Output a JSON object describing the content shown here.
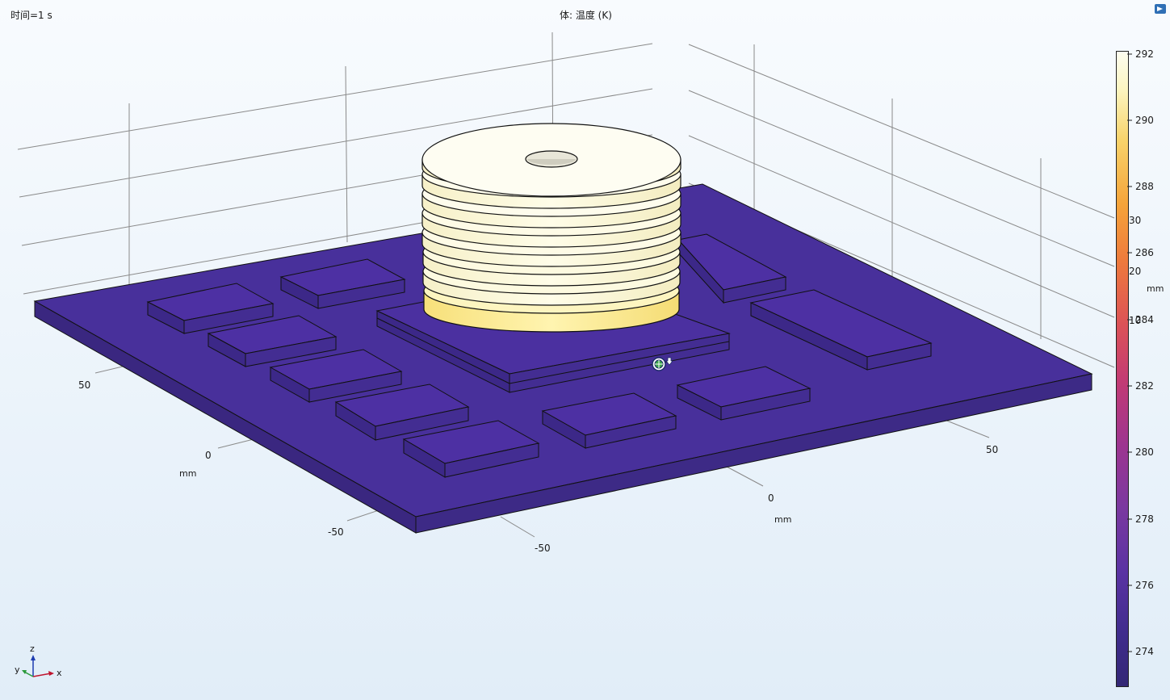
{
  "header": {
    "time_label": "时间=1 s",
    "plot_title": "体: 温度 (K)"
  },
  "colorbar": {
    "min": 273,
    "max": 292,
    "ticks": [
      "292",
      "290",
      "288",
      "286",
      "284",
      "282",
      "280",
      "278",
      "276",
      "274"
    ]
  },
  "axes": {
    "y_ticks": [
      "50",
      "0",
      "-50"
    ],
    "y_unit": "mm",
    "x_ticks": [
      "50",
      "0",
      "-50"
    ],
    "x_unit": "mm",
    "z_ticks": [
      "30",
      "20",
      "10"
    ],
    "z_unit": "mm"
  },
  "triad": {
    "z": "z",
    "y": "y",
    "x": "x"
  },
  "colors": {
    "board_top": "#48309b",
    "board_side": "#3a2780",
    "chip_top": "#4b2f9f",
    "heatsink_hot": "#fdfae0",
    "heatsink_base": "#fbeb9a"
  },
  "icons": [
    "app-logo-icon",
    "probe-cursor-icon",
    "axis-triad-icon"
  ]
}
